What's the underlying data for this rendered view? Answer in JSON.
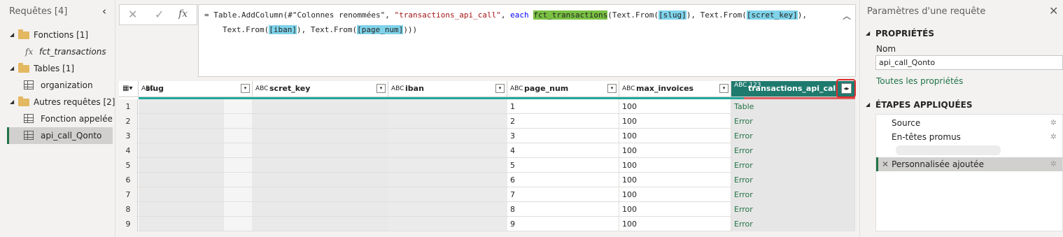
{
  "left_panel": {
    "title": "Requêtes [4]",
    "items": [
      {
        "label": "Fonctions [1]",
        "type": "folder"
      },
      {
        "label": "fct_transactions",
        "type": "function"
      },
      {
        "label": "Tables [1]",
        "type": "folder"
      },
      {
        "label": "organization",
        "type": "table"
      },
      {
        "label": "Autres requêtes [2]",
        "type": "folder"
      },
      {
        "label": "Fonction appelée",
        "type": "table"
      },
      {
        "label": "api_call_Qonto",
        "type": "table",
        "selected": true
      }
    ]
  },
  "formula": {
    "prefix": "= Table.AddColumn(#\"Colonnes renommées\", ",
    "str1": "\"transactions_api_call\"",
    "sep1": ", ",
    "kw_each": "each",
    "fn": "fct_transactions",
    "part1": "(Text.From(",
    "slug": "[slug]",
    "part2": "), Text.From(",
    "scret": "[scret_key]",
    "part3": "),",
    "part4": "Text.From(",
    "iban": "[iban]",
    "part5": "), Text.From(",
    "pagenum": "[page_num]",
    "part6": ")))",
    "cancel_glyph": "✕",
    "commit_glyph": "✓",
    "fx_glyph": "fx"
  },
  "columns": [
    {
      "type": "ABC",
      "name": "slug"
    },
    {
      "type": "ABC",
      "name": "scret_key"
    },
    {
      "type": "ABC",
      "name": "iban"
    },
    {
      "type": "ABC",
      "name": "page_num"
    },
    {
      "type": "ABC",
      "name": "max_invoices"
    },
    {
      "type": "ABC 123",
      "name": "transactions_api_call"
    }
  ],
  "rows": [
    {
      "n": "1",
      "page_num": "1",
      "max_invoices": "100",
      "tx": "Table"
    },
    {
      "n": "2",
      "page_num": "2",
      "max_invoices": "100",
      "tx": "Error"
    },
    {
      "n": "3",
      "page_num": "3",
      "max_invoices": "100",
      "tx": "Error"
    },
    {
      "n": "4",
      "page_num": "4",
      "max_invoices": "100",
      "tx": "Error"
    },
    {
      "n": "5",
      "page_num": "5",
      "max_invoices": "100",
      "tx": "Error"
    },
    {
      "n": "6",
      "page_num": "6",
      "max_invoices": "100",
      "tx": "Error"
    },
    {
      "n": "7",
      "page_num": "7",
      "max_invoices": "100",
      "tx": "Error"
    },
    {
      "n": "8",
      "page_num": "8",
      "max_invoices": "100",
      "tx": "Error"
    },
    {
      "n": "9",
      "page_num": "9",
      "max_invoices": "100",
      "tx": "Error"
    }
  ],
  "right_panel": {
    "title": "Paramètres d'une requête",
    "properties_header": "PROPRIÉTÉS",
    "name_label": "Nom",
    "name_value": "api_call_Qonto",
    "all_props_link": "Toutes les propriétés",
    "steps_header": "ÉTAPES APPLIQUÉES",
    "steps": [
      {
        "label": "Source"
      },
      {
        "label": "En-têtes promus"
      },
      {
        "label": "Personnalisée ajoutée",
        "selected": true
      }
    ]
  },
  "colors": {
    "accent_green": "#217346",
    "active_header": "#1f7a6e",
    "highlight_yellow": "#e5e500",
    "frame_red": "#e02d2d"
  }
}
